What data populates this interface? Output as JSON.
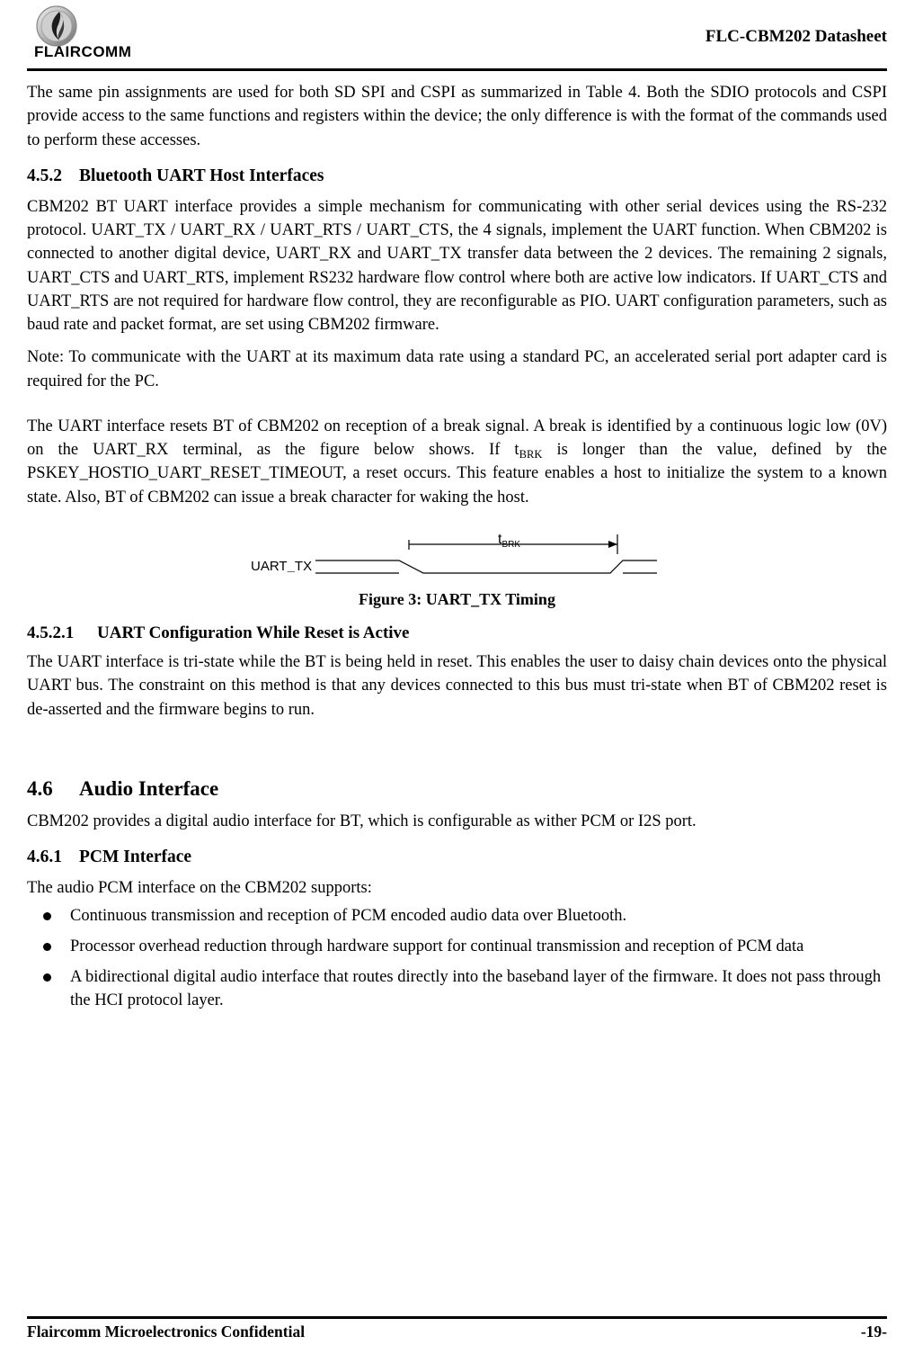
{
  "header": {
    "logo_text": "FLAIRCOMM",
    "title": "FLC-CBM202 Datasheet"
  },
  "content": {
    "intro_paragraph": "The same pin assignments are used for both SD SPI and CSPI as summarized in Table 4. Both the SDIO protocols and CSPI provide access to the same functions and registers within the device; the only difference is with the format of the commands used to perform these accesses.",
    "section_452": {
      "number": "4.5.2",
      "title": "Bluetooth UART Host Interfaces",
      "p1": "CBM202 BT UART interface provides a simple mechanism for communicating with other serial devices using the RS-232 protocol. UART_TX / UART_RX / UART_RTS / UART_CTS, the 4 signals, implement the UART function. When CBM202 is connected to another digital device, UART_RX and UART_TX transfer data between the 2 devices. The remaining 2 signals, UART_CTS and UART_RTS, implement RS232 hardware flow control where both are active low indicators.  If UART_CTS and UART_RTS are not required for hardware flow control, they are reconfigurable as PIO.  UART configuration parameters, such as baud rate and packet format, are set using CBM202 firmware.",
      "p2": "Note: To communicate with the UART at its maximum data rate using a standard PC, an accelerated serial port adapter card is required for the PC.",
      "p3_part1": "The UART interface resets BT of CBM202 on reception of a break signal. A break is identified by a continuous logic low (0V) on the UART_RX terminal, as the figure below shows. If t",
      "p3_sub": "BRK",
      "p3_part2": " is longer than the value, defined by the PSKEY_HOSTIO_UART_RESET_TIMEOUT, a reset occurs. This feature enables a host to initialize the system to a known state. Also, BT of CBM202 can issue a break character for waking the host."
    },
    "figure": {
      "signal_label_prefix": "UART",
      "signal_label_suffix": "_TX",
      "timing_label_main": "t",
      "timing_label_sub": "BRK",
      "caption": "Figure 3: UART_TX Timing"
    },
    "section_4521": {
      "number": "4.5.2.1",
      "title": "UART Configuration While Reset is Active",
      "p1": "The UART interface is tri-state while the BT is being held in reset. This enables the user to daisy chain devices onto the physical UART bus. The constraint on this method is that any devices connected to this bus must tri-state when BT of CBM202 reset is de-asserted and the firmware begins to run."
    },
    "section_46": {
      "number": "4.6",
      "title": "Audio Interface",
      "p1": "CBM202 provides a digital audio interface for BT, which is configurable as wither PCM or I2S port."
    },
    "section_461": {
      "number": "4.6.1",
      "title": "PCM Interface",
      "p1": "The audio PCM interface on the CBM202 supports:",
      "bullets": [
        "Continuous transmission and reception of PCM encoded audio data over Bluetooth.",
        "Processor overhead reduction through hardware support for continual transmission and reception of PCM data",
        "A bidirectional digital audio interface that routes directly into the baseband layer of the firmware. It does not pass through the HCI protocol layer."
      ]
    }
  },
  "footer": {
    "left": "Flaircomm Microelectronics Confidential",
    "right": "-19-"
  }
}
